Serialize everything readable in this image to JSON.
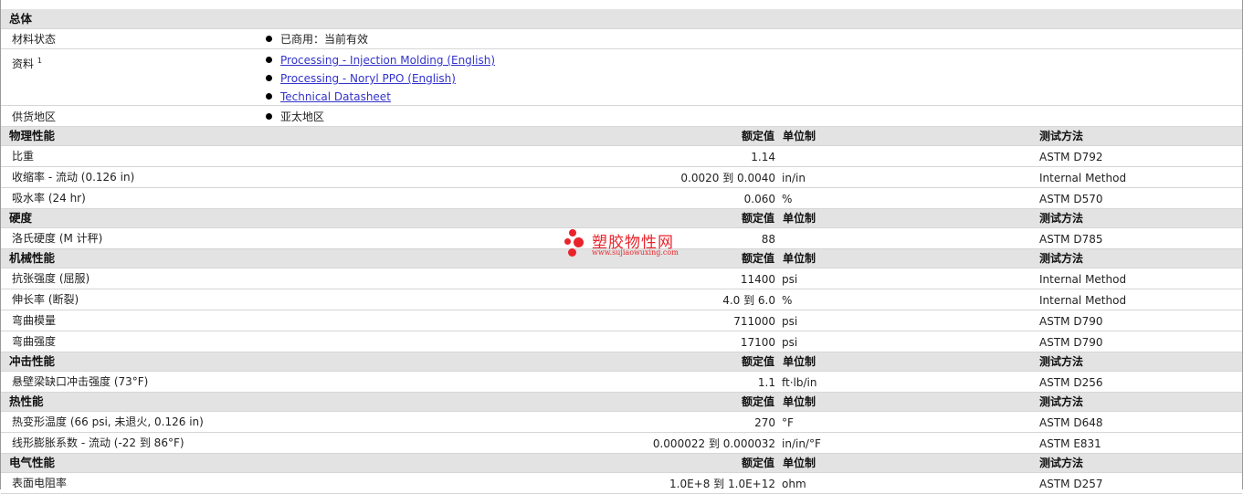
{
  "general": {
    "section_title": "总体",
    "rows": [
      {
        "label": "材料状态",
        "items": [
          "已商用：当前有效"
        ]
      },
      {
        "label": "资料",
        "sup": "1",
        "links": [
          "Processing - Injection Molding (English)",
          "Processing - Noryl PPO (English)",
          "Technical Datasheet"
        ]
      },
      {
        "label": "供货地区",
        "items": [
          "亚太地区"
        ]
      }
    ]
  },
  "columns": {
    "value": "额定值",
    "unit": "单位制",
    "method": "测试方法"
  },
  "sections": [
    {
      "title": "物理性能",
      "rows": [
        {
          "label": "比重",
          "value": "1.14",
          "unit": "",
          "method": "ASTM D792"
        },
        {
          "label": "收缩率 - 流动 (0.126 in)",
          "value": "0.0020 到 0.0040",
          "unit": "in/in",
          "method": "Internal Method"
        },
        {
          "label": "吸水率 (24 hr)",
          "value": "0.060",
          "unit": "%",
          "method": "ASTM D570"
        }
      ]
    },
    {
      "title": "硬度",
      "rows": [
        {
          "label": "洛氏硬度 (M 计秤)",
          "value": "88",
          "unit": "",
          "method": "ASTM D785"
        }
      ]
    },
    {
      "title": "机械性能",
      "rows": [
        {
          "label": "抗张强度 (屈服)",
          "value": "11400",
          "unit": "psi",
          "method": "Internal Method"
        },
        {
          "label": "伸长率 (断裂)",
          "value": "4.0 到 6.0",
          "unit": "%",
          "method": "Internal Method"
        },
        {
          "label": "弯曲模量",
          "value": "711000",
          "unit": "psi",
          "method": "ASTM D790"
        },
        {
          "label": "弯曲强度",
          "value": "17100",
          "unit": "psi",
          "method": "ASTM D790"
        }
      ]
    },
    {
      "title": "冲击性能",
      "rows": [
        {
          "label": "悬壁梁缺口冲击强度 (73°F)",
          "value": "1.1",
          "unit": "ft·lb/in",
          "method": "ASTM D256"
        }
      ]
    },
    {
      "title": "热性能",
      "rows": [
        {
          "label": "热变形温度 (66 psi, 未退火, 0.126 in)",
          "value": "270",
          "unit": "°F",
          "method": "ASTM D648"
        },
        {
          "label": "线形膨胀系数 - 流动 (-22 到 86°F)",
          "value": "0.000022 到 0.000032",
          "unit": "in/in/°F",
          "method": "ASTM E831"
        }
      ]
    },
    {
      "title": "电气性能",
      "rows": [
        {
          "label": "表面电阻率",
          "value": "1.0E+8 到 1.0E+12",
          "unit": "ohm",
          "method": "ASTM D257"
        }
      ]
    }
  ],
  "watermark": {
    "name": "塑胶物性网",
    "url": "www.sujiaowuxing.com",
    "color": "#e8242b"
  },
  "icons": {
    "cursor": "mouse-pointer-icon",
    "bullet": "bullet-dot-icon",
    "logo": "logo-dots-icon"
  }
}
